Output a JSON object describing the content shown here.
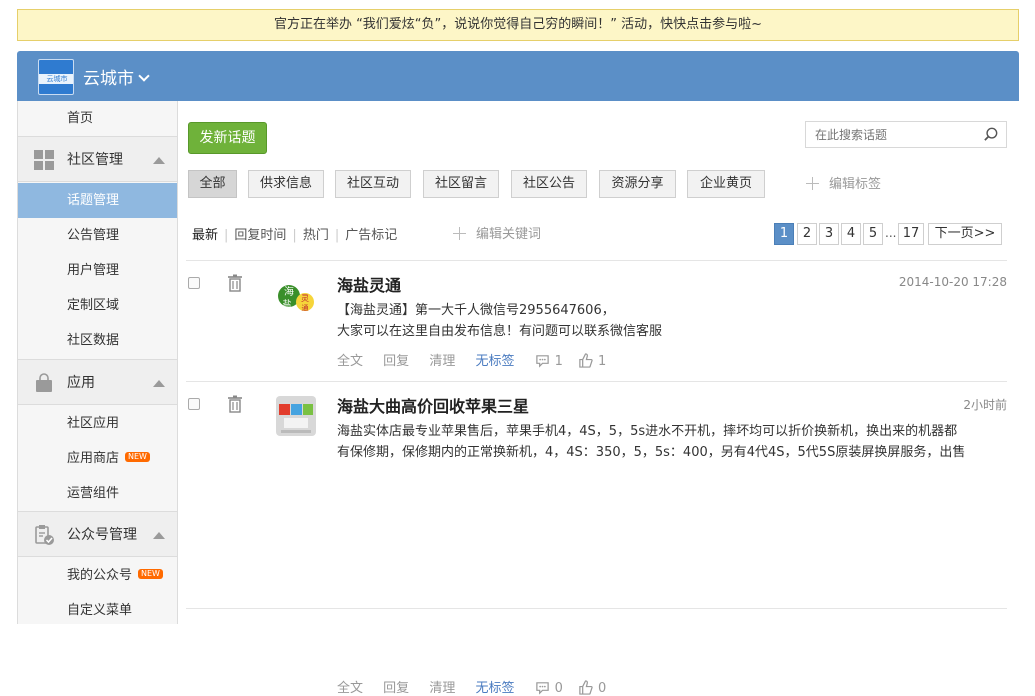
{
  "notice": "官方正在举办 “我们爱炫“负”，说说你觉得自己穷的瞬间！” 活动，快快点击参与啦~",
  "header": {
    "logo_text": "云城市",
    "city": "云城市"
  },
  "sidebar": {
    "home": "首页",
    "groups": [
      {
        "label": "社区管理",
        "icon": "grid-icon",
        "items": [
          "话题管理",
          "公告管理",
          "用户管理",
          "定制区域",
          "社区数据"
        ]
      },
      {
        "label": "应用",
        "icon": "bag-icon",
        "items": [
          "社区应用",
          "应用商店",
          "运营组件"
        ]
      },
      {
        "label": "公众号管理",
        "icon": "clipboard-check-icon",
        "items": [
          "我的公众号",
          "自定义菜单"
        ]
      }
    ],
    "active_item": "话题管理",
    "new_badge": "NEW"
  },
  "toolbar": {
    "new_topic": "发新话题",
    "search_placeholder": "在此搜索话题",
    "edit_tags": "编辑标签",
    "edit_keywords": "编辑关键词"
  },
  "tags": [
    "全部",
    "供求信息",
    "社区互动",
    "社区留言",
    "社区公告",
    "资源分享",
    "企业黄页"
  ],
  "sorts": [
    "最新",
    "回复时间",
    "热门",
    "广告标记"
  ],
  "pager": {
    "pages": [
      "1",
      "2",
      "3",
      "4",
      "5"
    ],
    "ellipsis": "...",
    "last": "17",
    "next": "下一页>>"
  },
  "posts": [
    {
      "title": "海盐灵通",
      "time": "2014-10-20 17:28",
      "body": [
        "【海盐灵通】第一大千人微信号2955647606，",
        "大家可以在这里自由发布信息！有问题可以联系微信客服"
      ],
      "actions": {
        "full": "全文",
        "reply": "回复",
        "clean": "清理",
        "tag": "无标签"
      },
      "comments": "1",
      "likes": "1"
    },
    {
      "title": "海盐大曲高价回收苹果三星",
      "time": "2小时前",
      "body": [
        "海盐实体店最专业苹果售后，苹果手机4，4S，5，5s进水不开机，摔坏均可以折价换新机，换出来的机器都",
        "有保修期，保修期内的正常换新机，4，4S：350，5，5s：400，另有4代4S，5代5S原装屏换屏服务，出售"
      ],
      "actions": {
        "full": "全文",
        "reply": "回复",
        "clean": "清理",
        "tag": "无标签"
      },
      "comments": "0",
      "likes": "0"
    }
  ]
}
